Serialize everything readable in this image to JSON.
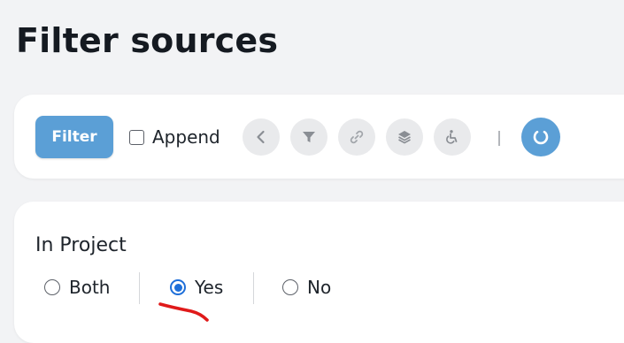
{
  "page": {
    "title": "Filter sources"
  },
  "toolbar": {
    "filter_label": "Filter",
    "append_label": "Append",
    "append_checked": false,
    "icons": [
      "chevron-left-icon",
      "funnel-icon",
      "link-icon",
      "layers-icon",
      "wheelchair-icon"
    ],
    "refresh_icon": "refresh-icon"
  },
  "in_project": {
    "label": "In Project",
    "options": [
      {
        "label": "Both",
        "checked": false
      },
      {
        "label": "Yes",
        "checked": true
      },
      {
        "label": "No",
        "checked": false
      }
    ]
  },
  "colors": {
    "accent": "#5b9fd6",
    "radio_checked": "#1e6fd9",
    "annotation_red": "#e01a1a"
  }
}
